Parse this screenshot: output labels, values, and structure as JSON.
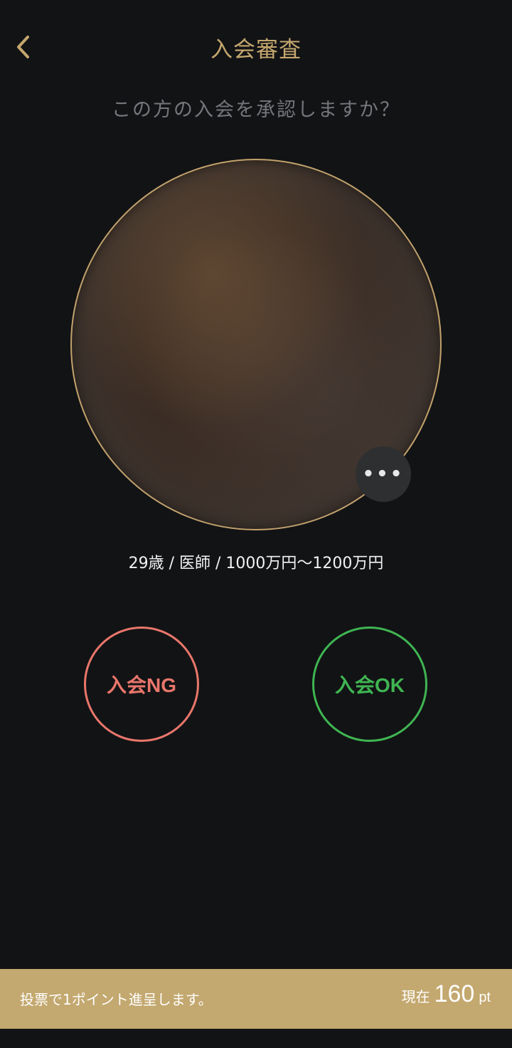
{
  "header": {
    "title": "入会審査",
    "back_icon": "chevron-left-icon"
  },
  "prompt": "この方の入会を承認しますか？",
  "profile": {
    "info": "29歳 / 医師 / 1000万円〜1200万円",
    "more_icon": "more-horizontal-icon"
  },
  "actions": {
    "ng_label": "入会NG",
    "ok_label": "入会OK"
  },
  "footer": {
    "note": "投票で1ポイント進呈します。",
    "points_prefix": "現在",
    "points_value": "160",
    "points_unit": "pt"
  },
  "colors": {
    "accent_gold": "#c4a76e",
    "background": "#121315",
    "ng_red": "#e9766b",
    "ok_green": "#3fb552"
  }
}
